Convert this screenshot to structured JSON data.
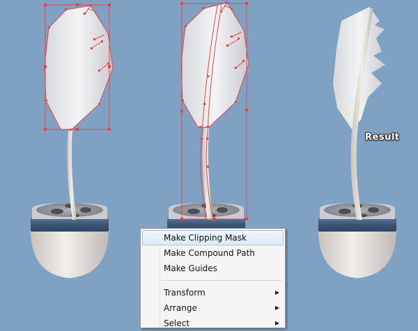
{
  "result_label": "Result",
  "context_menu": {
    "items": [
      {
        "label": "Make Clipping Mask",
        "highlighted": true
      },
      {
        "label": "Make Compound Path"
      },
      {
        "label": "Make Guides"
      }
    ],
    "submenu_items": [
      {
        "label": "Transform"
      },
      {
        "label": "Arrange"
      },
      {
        "label": "Select"
      }
    ]
  },
  "colors": {
    "background": "#7fa2c2",
    "selection": "#e8434b",
    "pot_band": "#3e5a78",
    "pot_body": "#e3dedb"
  }
}
